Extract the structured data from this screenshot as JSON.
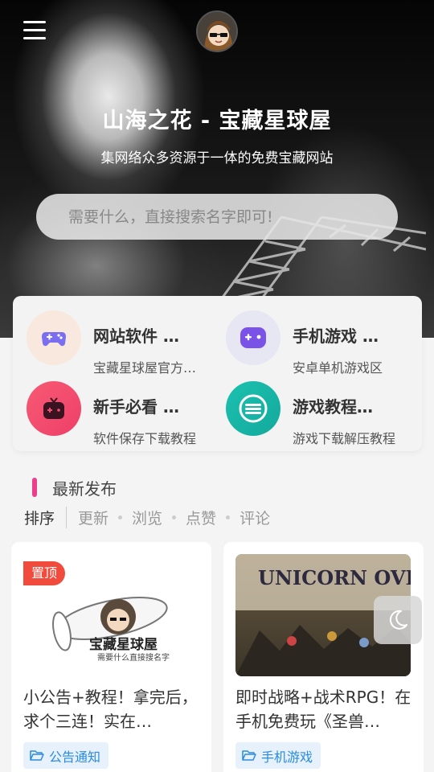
{
  "header": {
    "site_title": "山海之花 - 宝藏星球屋",
    "subtitle": "集网络众多资源于一体的免费宝藏网站",
    "search_placeholder": "需要什么，直接搜索名字即可!"
  },
  "categories": [
    {
      "title": "网站软件 …",
      "desc": "宝藏星球屋官方…",
      "icon": "gamepad-icon",
      "color": "#7b6ff0"
    },
    {
      "title": "手机游戏 …",
      "desc": "安卓单机游戏区",
      "icon": "game-controller-icon",
      "color": "#7a52e8"
    },
    {
      "title": "新手必看 …",
      "desc": "软件保存下载教程",
      "icon": "tv-game-icon",
      "color": "#f0506e"
    },
    {
      "title": "游戏教程…",
      "desc": "游戏下载解压教程",
      "icon": "circle-logo-icon",
      "color": "#1fb5a6"
    }
  ],
  "latest": {
    "title": "最新发布",
    "sort_label": "排序",
    "sort_options": [
      "更新",
      "浏览",
      "点赞",
      "评论"
    ]
  },
  "posts": [
    {
      "pin": "置顶",
      "title": "小公告+教程！拿完后，求个三连！实在…",
      "tag": "公告通知"
    },
    {
      "title": "即时战略+战术RPG！在手机免费玩《圣兽…",
      "tag": "手机游戏",
      "image_text": "UNICORN OVERLORD"
    }
  ]
}
